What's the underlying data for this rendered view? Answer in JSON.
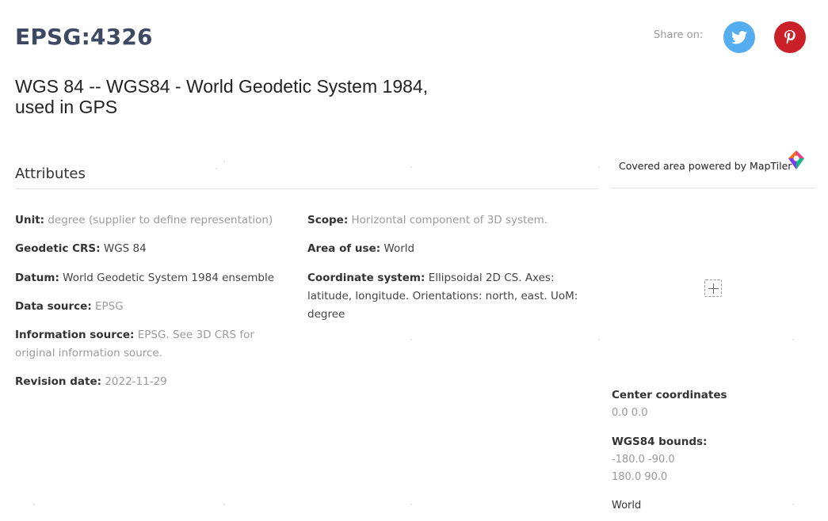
{
  "header": {
    "title": "EPSG:4326",
    "subtitle": "WGS 84 -- WGS84 - World Geodetic System 1984, used in GPS",
    "share_label": "Share on:",
    "share_icons": [
      "twitter-icon",
      "pinterest-icon"
    ],
    "colors": {
      "twitter": "#55acee",
      "pinterest": "#cb2027",
      "title": "#3d4963"
    }
  },
  "attributes": {
    "heading": "Attributes",
    "left": [
      {
        "key": "Unit:",
        "value": "degree (supplier to define representation)"
      },
      {
        "key": "Geodetic CRS:",
        "value": "WGS 84"
      },
      {
        "key": "Datum:",
        "value": "World Geodetic System 1984 ensemble"
      },
      {
        "key": "Data source:",
        "value": "EPSG"
      },
      {
        "key": "Information source:",
        "value": "EPSG. See 3D CRS for original information source."
      },
      {
        "key": "Revision date:",
        "value": "2022-11-29"
      }
    ],
    "right": [
      {
        "key": "Scope:",
        "value": "Horizontal component of 3D system."
      },
      {
        "key": "Area of use:",
        "value": "World"
      },
      {
        "key": "Coordinate system:",
        "value": "Ellipsoidal 2D CS. Axes: latitude, longitude. Orientations: north, east. UoM: degree"
      }
    ]
  },
  "map": {
    "powered_by": "Covered area powered by MapTiler",
    "center_label": "Center coordinates",
    "center_value": "0.0 0.0",
    "bounds_label": "WGS84 bounds:",
    "bounds_line1": "-180.0 -90.0",
    "bounds_line2": "180.0 90.0",
    "area_name": "World"
  }
}
